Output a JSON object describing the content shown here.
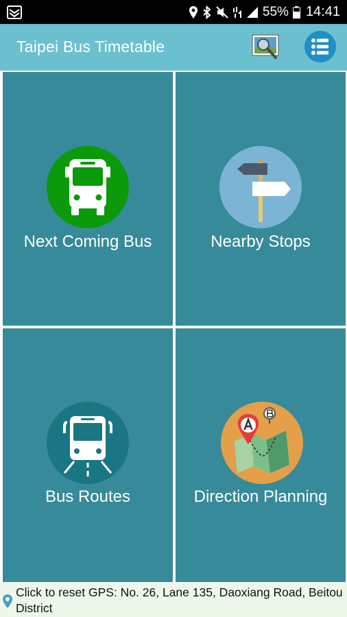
{
  "status_bar": {
    "battery": "55%",
    "time": "14:41",
    "icons": [
      "notification-icon",
      "location-icon",
      "bluetooth-icon",
      "mute-icon",
      "network-icon",
      "signal-icon",
      "battery-icon"
    ]
  },
  "app_bar": {
    "title": "Taipei Bus Timetable",
    "icons": [
      "map-search-icon",
      "list-menu-icon"
    ]
  },
  "tiles": [
    {
      "label": "Next Coming Bus",
      "icon": "bus-front-icon",
      "circle_color": "#0a9a0a"
    },
    {
      "label": "Nearby Stops",
      "icon": "signpost-icon",
      "circle_color": "#7cb4d6"
    },
    {
      "label": "Bus Routes",
      "icon": "bus-route-icon",
      "circle_color": "#1b7684"
    },
    {
      "label": "Direction Planning",
      "icon": "direction-map-icon",
      "circle_color": "#e4a048"
    }
  ],
  "footer": {
    "text": "Click to reset GPS: No. 26, Lane 135, Daoxiang Road, Beitou District",
    "icon": "location-pin-icon"
  },
  "colors": {
    "app_bar": "#6bc0d0",
    "tile": "#378a9a",
    "footer": "#eef8ea",
    "menu_button": "#1f8fc4"
  }
}
